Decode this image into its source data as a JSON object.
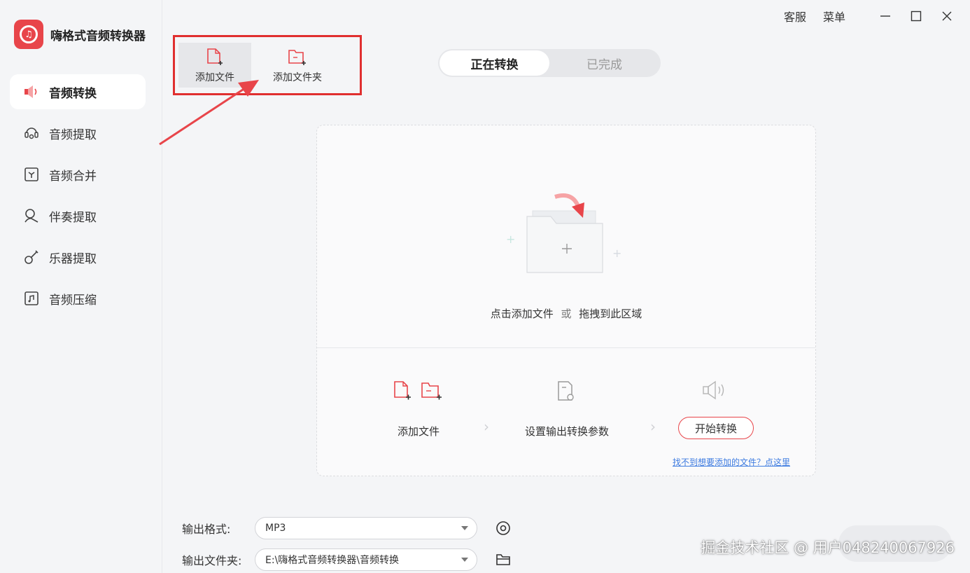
{
  "app": {
    "name": "嗨格式音频转换器",
    "accent_color": "#e8454a",
    "logo_icon": "music-note-icon"
  },
  "topbar": {
    "service": "客服",
    "menu": "菜单"
  },
  "sidebar": {
    "items": [
      {
        "label": "音频转换",
        "icon": "speaker-icon",
        "active": true
      },
      {
        "label": "音频提取",
        "icon": "audio-extract-icon",
        "active": false
      },
      {
        "label": "音频合并",
        "icon": "merge-icon",
        "active": false
      },
      {
        "label": "伴奏提取",
        "icon": "accompaniment-icon",
        "active": false
      },
      {
        "label": "乐器提取",
        "icon": "guitar-icon",
        "active": false
      },
      {
        "label": "音频压缩",
        "icon": "compress-icon",
        "active": false
      }
    ]
  },
  "toolbar": {
    "add_file": "添加文件",
    "add_folder": "添加文件夹",
    "highlight_color": "#e02f2f"
  },
  "tabs": [
    {
      "label": "正在转换",
      "active": true
    },
    {
      "label": "已完成",
      "active": false
    }
  ],
  "drop": {
    "hint_main": "点击添加文件",
    "hint_or": "或",
    "hint_drag": "拖拽到此区域",
    "steps": {
      "add_file": "添加文件",
      "set_params": "设置输出转换参数",
      "start": "开始转换"
    },
    "help_link": "找不到想要添加的文件？点这里"
  },
  "settings": {
    "format_label": "输出格式:",
    "format_value": "MP3",
    "folder_label": "输出文件夹:",
    "folder_value": "E:\\嗨格式音频转换器\\音频转换"
  },
  "watermark": "掘金技术社区 @ 用户048240067926"
}
